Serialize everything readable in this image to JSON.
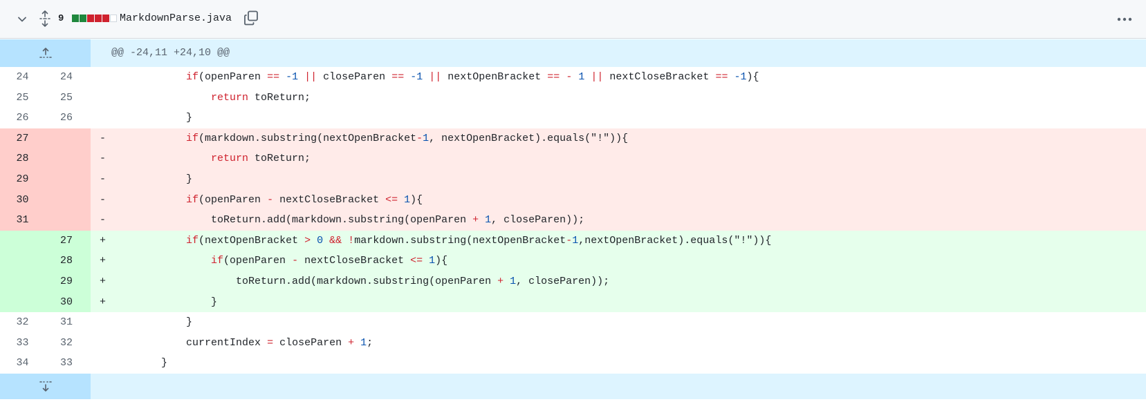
{
  "header": {
    "changes_count": "9",
    "diffstat": [
      "add",
      "add",
      "del",
      "del",
      "del",
      "neutral"
    ],
    "filename": "MarkdownParse.java"
  },
  "hunk": {
    "header": "@@ -24,11 +24,10 @@"
  },
  "colors": {
    "added_bg": "#e6ffec",
    "added_num_bg": "#ccffd8",
    "deleted_bg": "#ffebe9",
    "deleted_num_bg": "#ffcecb",
    "hunk_bg": "#ddf4ff",
    "expander_bg": "#b6e3ff",
    "keyword": "#cf222e",
    "number": "#0550ae"
  },
  "lines": [
    {
      "type": "ctx",
      "old": "24",
      "new": "24",
      "marker": "",
      "indent": "            ",
      "tokens": [
        [
          "kw",
          "if"
        ],
        [
          "",
          "(openParen "
        ],
        [
          "kw",
          "=="
        ],
        [
          "",
          " "
        ],
        [
          "nb",
          "-1"
        ],
        [
          "",
          " "
        ],
        [
          "kw",
          "||"
        ],
        [
          "",
          " closeParen "
        ],
        [
          "kw",
          "=="
        ],
        [
          "",
          " "
        ],
        [
          "nb",
          "-1"
        ],
        [
          "",
          " "
        ],
        [
          "kw",
          "||"
        ],
        [
          "",
          " nextOpenBracket "
        ],
        [
          "kw",
          "=="
        ],
        [
          "",
          " "
        ],
        [
          "kw",
          "-"
        ],
        [
          "",
          " "
        ],
        [
          "nb",
          "1"
        ],
        [
          "",
          " "
        ],
        [
          "kw",
          "||"
        ],
        [
          "",
          " nextCloseBracket "
        ],
        [
          "kw",
          "=="
        ],
        [
          "",
          " "
        ],
        [
          "nb",
          "-1"
        ],
        [
          "",
          "){"
        ]
      ]
    },
    {
      "type": "ctx",
      "old": "25",
      "new": "25",
      "marker": "",
      "indent": "                ",
      "tokens": [
        [
          "kw",
          "return"
        ],
        [
          "",
          " toReturn;"
        ]
      ]
    },
    {
      "type": "ctx",
      "old": "26",
      "new": "26",
      "marker": "",
      "indent": "            ",
      "tokens": [
        [
          "",
          "}"
        ]
      ]
    },
    {
      "type": "del",
      "old": "27",
      "new": "",
      "marker": "-",
      "indent": "            ",
      "tokens": [
        [
          "kw",
          "if"
        ],
        [
          "",
          "(markdown.substring(nextOpenBracket"
        ],
        [
          "kw",
          "-"
        ],
        [
          "nb",
          "1"
        ],
        [
          "",
          ", nextOpenBracket).equals(\"!\")){"
        ]
      ]
    },
    {
      "type": "del",
      "old": "28",
      "new": "",
      "marker": "-",
      "indent": "                ",
      "tokens": [
        [
          "kw",
          "return"
        ],
        [
          "",
          " toReturn;"
        ]
      ]
    },
    {
      "type": "del",
      "old": "29",
      "new": "",
      "marker": "-",
      "indent": "            ",
      "tokens": [
        [
          "",
          "}"
        ]
      ]
    },
    {
      "type": "del",
      "old": "30",
      "new": "",
      "marker": "-",
      "indent": "            ",
      "tokens": [
        [
          "kw",
          "if"
        ],
        [
          "",
          "(openParen "
        ],
        [
          "kw",
          "-"
        ],
        [
          "",
          " nextCloseBracket "
        ],
        [
          "kw",
          "<="
        ],
        [
          "",
          " "
        ],
        [
          "nb",
          "1"
        ],
        [
          "",
          "){"
        ]
      ]
    },
    {
      "type": "del",
      "old": "31",
      "new": "",
      "marker": "-",
      "indent": "                ",
      "tokens": [
        [
          "",
          "toReturn.add(markdown.substring(openParen "
        ],
        [
          "kw",
          "+"
        ],
        [
          "",
          " "
        ],
        [
          "nb",
          "1"
        ],
        [
          "",
          ", closeParen));"
        ]
      ]
    },
    {
      "type": "add",
      "old": "",
      "new": "27",
      "marker": "+",
      "indent": "            ",
      "tokens": [
        [
          "kw",
          "if"
        ],
        [
          "",
          "(nextOpenBracket "
        ],
        [
          "kw",
          ">"
        ],
        [
          "",
          " "
        ],
        [
          "nb",
          "0"
        ],
        [
          "",
          " "
        ],
        [
          "kw",
          "&&"
        ],
        [
          "",
          " "
        ],
        [
          "kw",
          "!"
        ],
        [
          "",
          "markdown.substring(nextOpenBracket"
        ],
        [
          "kw",
          "-"
        ],
        [
          "nb",
          "1"
        ],
        [
          "",
          ",nextOpenBracket).equals(\"!\")){"
        ]
      ]
    },
    {
      "type": "add",
      "old": "",
      "new": "28",
      "marker": "+",
      "indent": "                ",
      "tokens": [
        [
          "kw",
          "if"
        ],
        [
          "",
          "(openParen "
        ],
        [
          "kw",
          "-"
        ],
        [
          "",
          " nextCloseBracket "
        ],
        [
          "kw",
          "<="
        ],
        [
          "",
          " "
        ],
        [
          "nb",
          "1"
        ],
        [
          "",
          "){"
        ]
      ]
    },
    {
      "type": "add",
      "old": "",
      "new": "29",
      "marker": "+",
      "indent": "                    ",
      "tokens": [
        [
          "",
          "toReturn.add(markdown.substring(openParen "
        ],
        [
          "kw",
          "+"
        ],
        [
          "",
          " "
        ],
        [
          "nb",
          "1"
        ],
        [
          "",
          ", closeParen));"
        ]
      ]
    },
    {
      "type": "add",
      "old": "",
      "new": "30",
      "marker": "+",
      "indent": "                ",
      "tokens": [
        [
          "",
          "}"
        ]
      ]
    },
    {
      "type": "ctx",
      "old": "32",
      "new": "31",
      "marker": "",
      "indent": "            ",
      "tokens": [
        [
          "",
          "}"
        ]
      ]
    },
    {
      "type": "ctx",
      "old": "33",
      "new": "32",
      "marker": "",
      "indent": "            ",
      "tokens": [
        [
          "",
          "currentIndex "
        ],
        [
          "kw",
          "="
        ],
        [
          "",
          " closeParen "
        ],
        [
          "kw",
          "+"
        ],
        [
          "",
          " "
        ],
        [
          "nb",
          "1"
        ],
        [
          "",
          ";"
        ]
      ]
    },
    {
      "type": "ctx",
      "old": "34",
      "new": "33",
      "marker": "",
      "indent": "        ",
      "tokens": [
        [
          "",
          "}"
        ]
      ]
    }
  ]
}
